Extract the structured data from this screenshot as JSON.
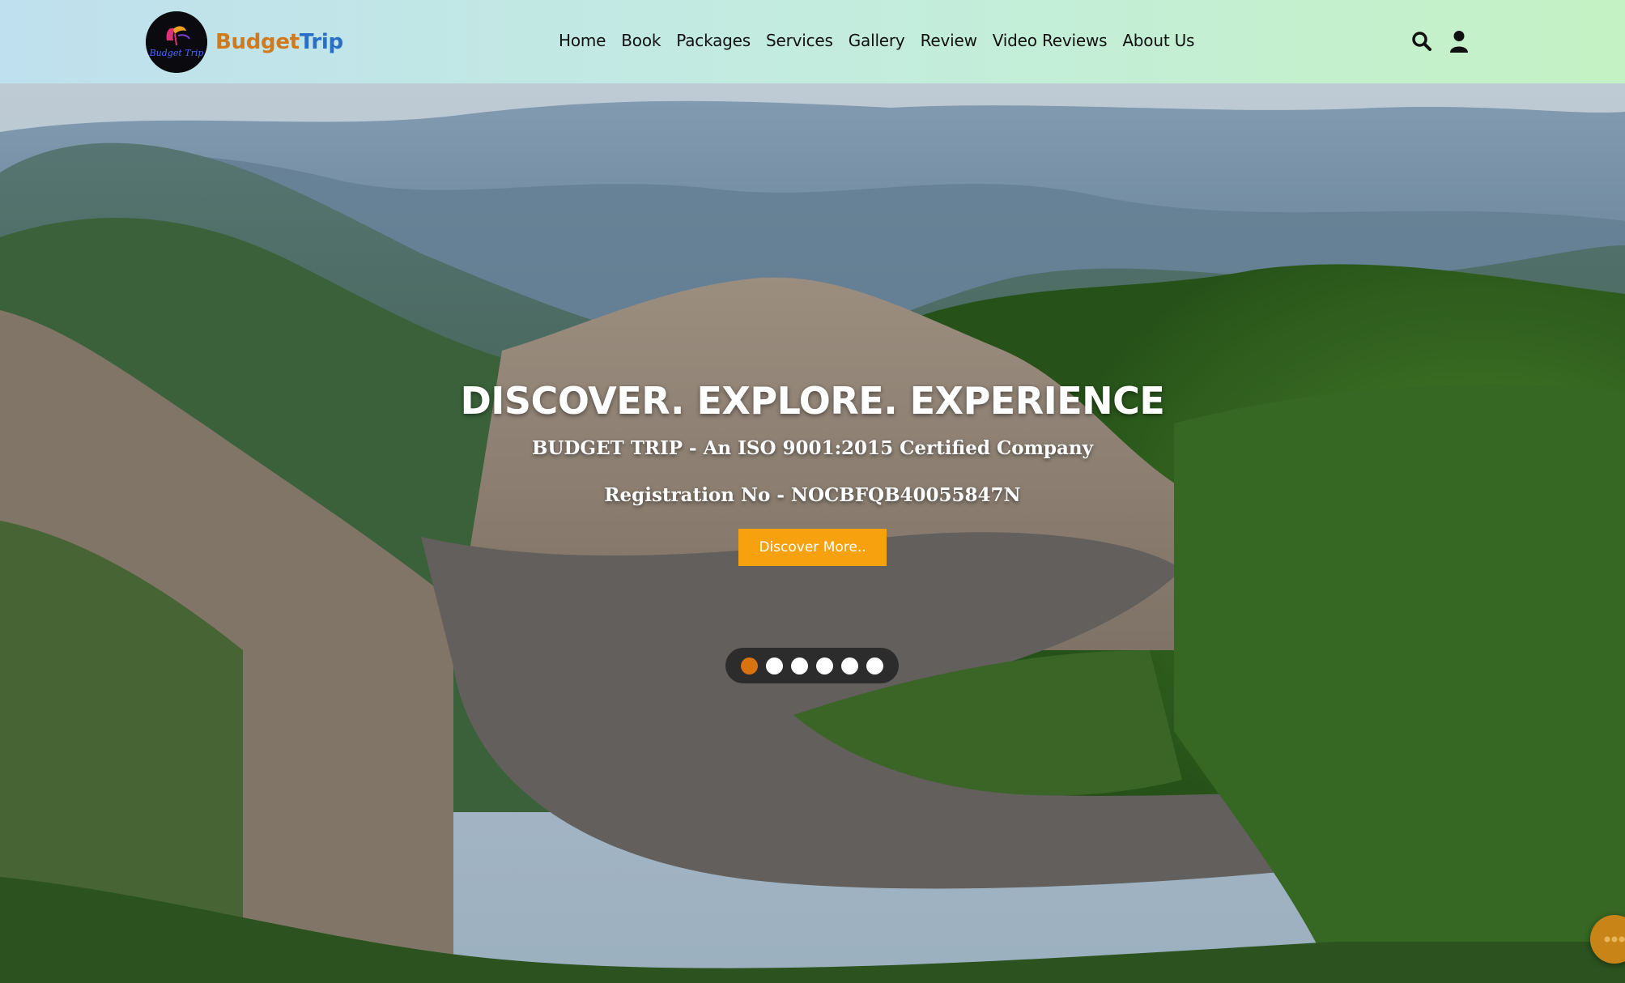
{
  "header": {
    "logo_text": "Budget Trip",
    "brand_part1": "Budget",
    "brand_part2": "Trip",
    "brand_color_1": "#d07a1e",
    "brand_color_2": "#2a6fc4",
    "nav": [
      "Home",
      "Book",
      "Packages",
      "Services",
      "Gallery",
      "Review",
      "Video Reviews",
      "About Us"
    ],
    "icons": [
      "search-icon",
      "user-icon"
    ]
  },
  "hero": {
    "headline": "DISCOVER. EXPLORE. EXPERIENCE",
    "subline": "BUDGET TRIP - An ISO 9001:2015 Certified Company",
    "registration": "Registration No - NOCBFQB40055847N",
    "cta_label": "Discover More..",
    "cta_color": "#f6a10d",
    "slides_total": 6,
    "active_slide": 1,
    "active_dot_color": "#d8730f"
  },
  "chat": {
    "icon": "chat-bubble-icon",
    "color": "#c98418"
  }
}
